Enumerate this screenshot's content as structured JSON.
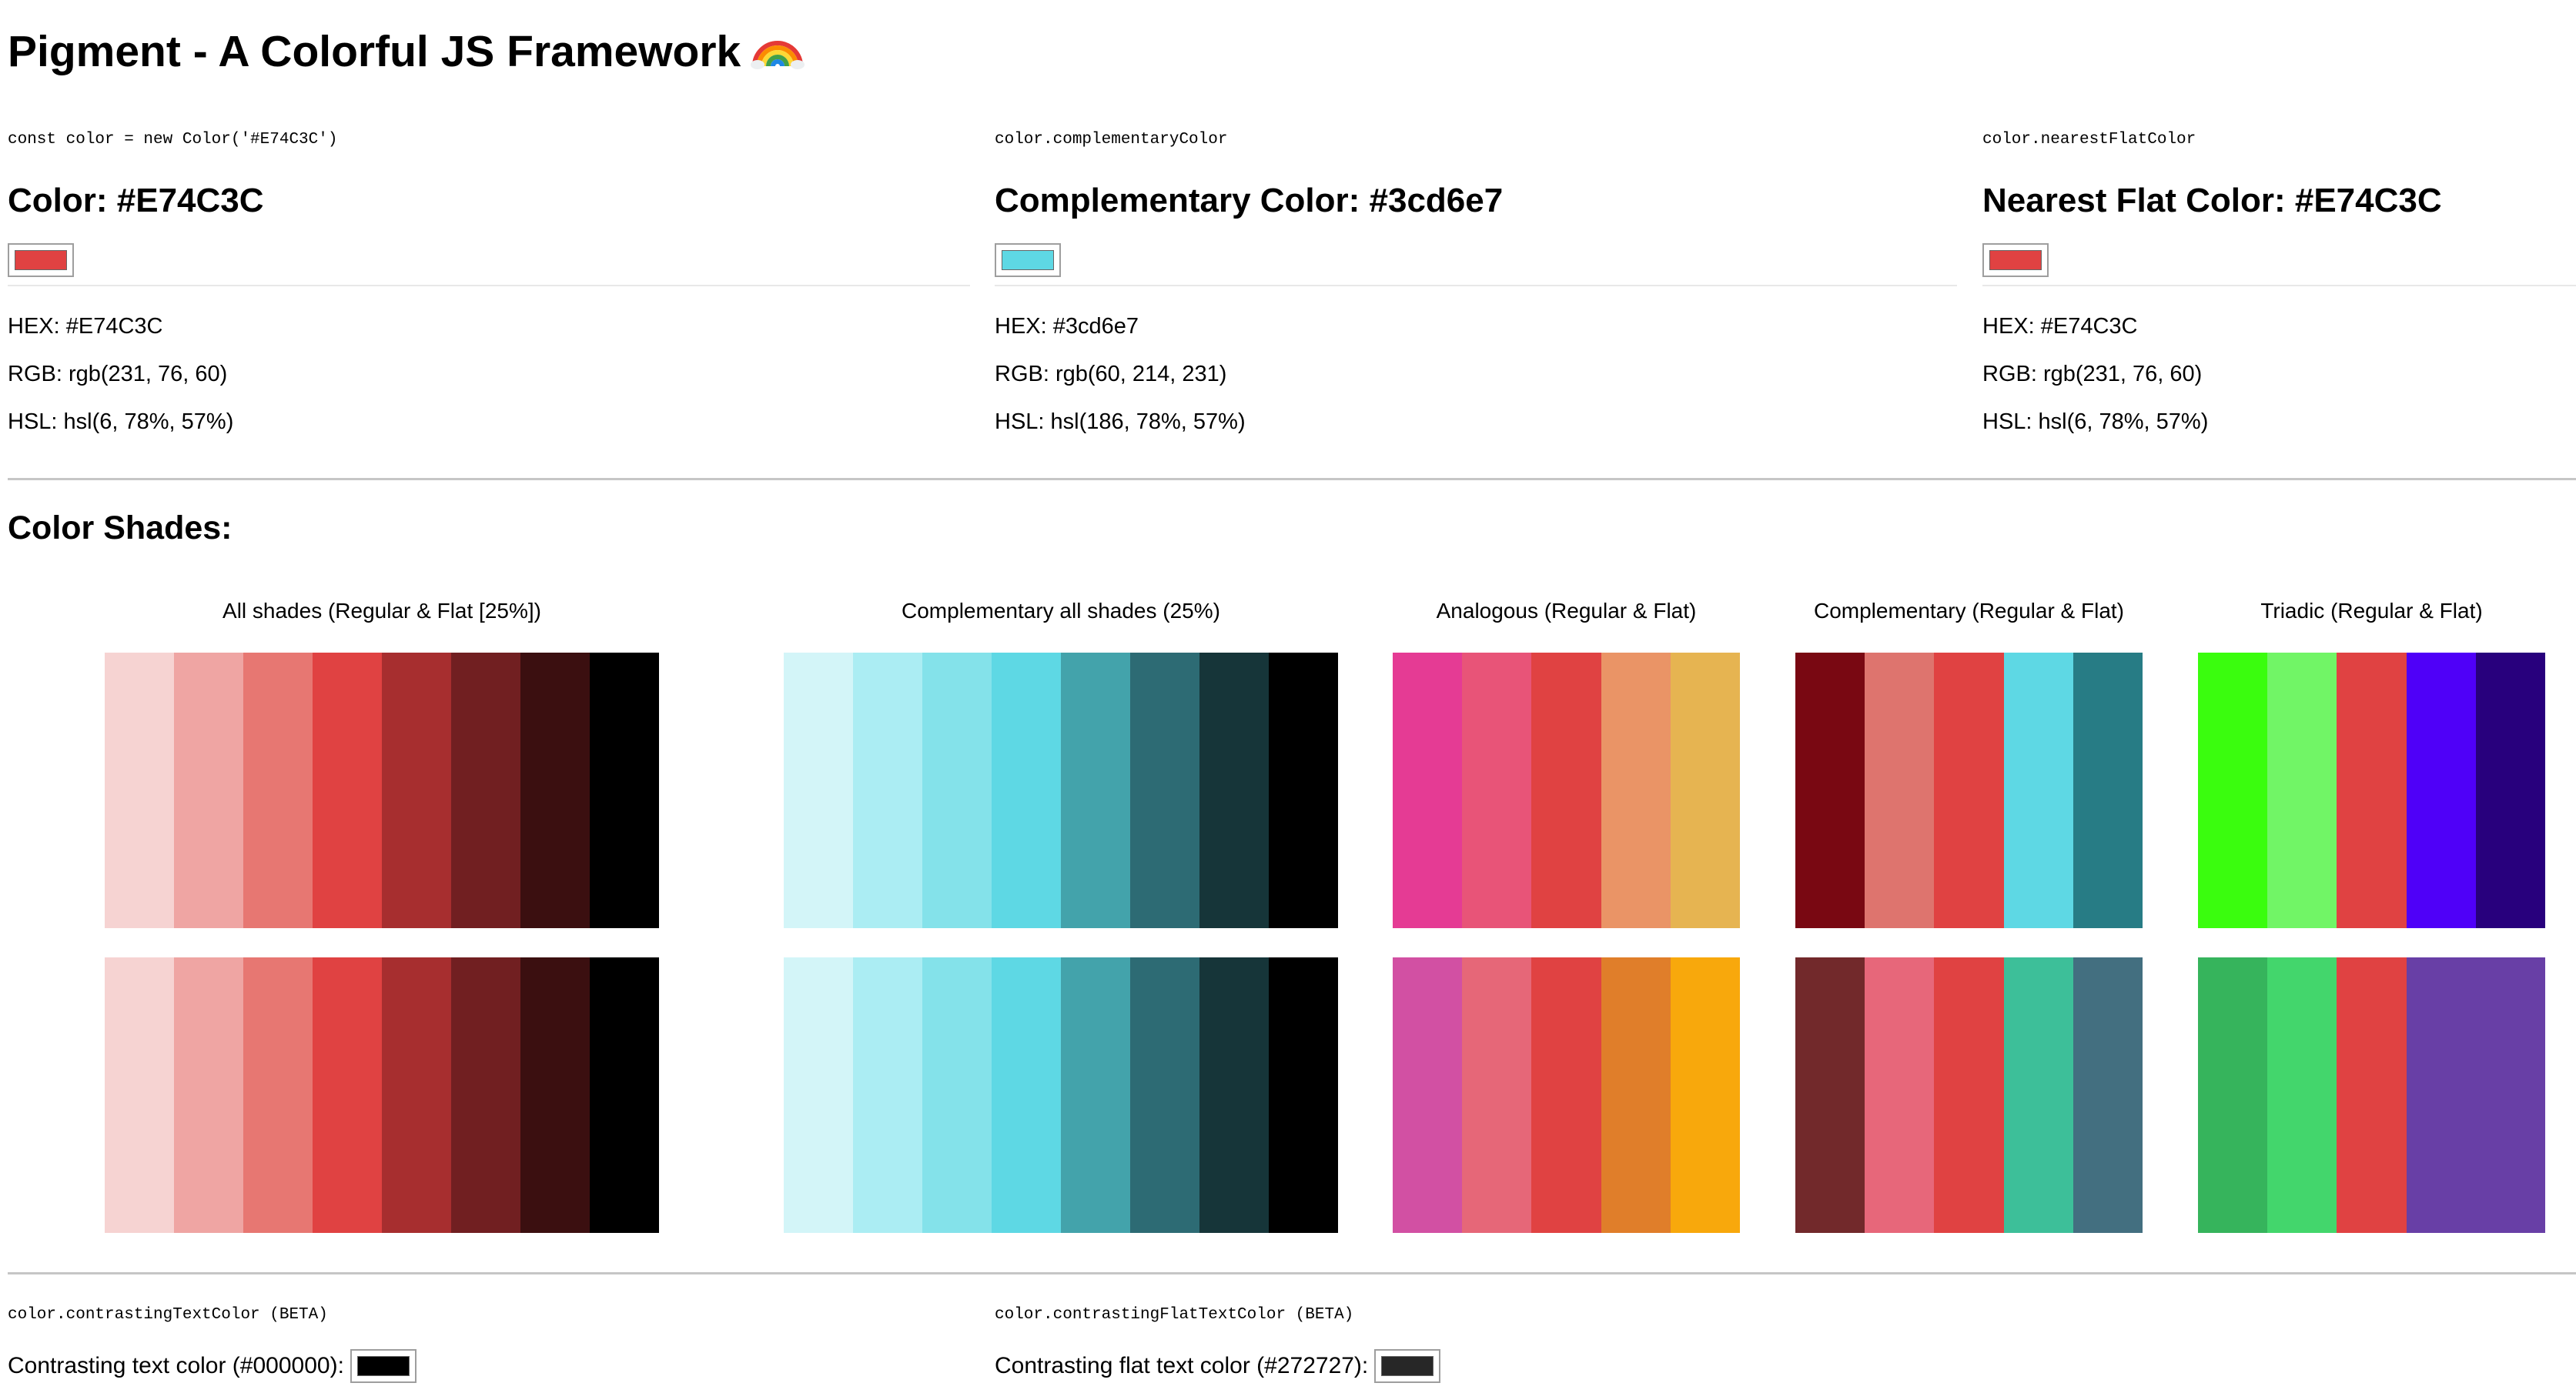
{
  "title": "Pigment - A Colorful JS Framework",
  "columns": [
    {
      "code": "const color = new Color('#E74C3C')",
      "heading": "Color: #E74C3C",
      "swatch": "#E04242",
      "hex": "HEX: #E74C3C",
      "rgb": "RGB: rgb(231, 76, 60)",
      "hsl": "HSL: hsl(6, 78%, 57%)"
    },
    {
      "code": "color.complementaryColor",
      "heading": "Complementary Color: #3cd6e7",
      "swatch": "#5ED8E4",
      "hex": "HEX: #3cd6e7",
      "rgb": "RGB: rgb(60, 214, 231)",
      "hsl": "HSL: hsl(186, 78%, 57%)"
    },
    {
      "code": "color.nearestFlatColor",
      "heading": "Nearest Flat Color: #E74C3C",
      "swatch": "#E04242",
      "hex": "HEX: #E74C3C",
      "rgb": "RGB: rgb(231, 76, 60)",
      "hsl": "HSL: hsl(6, 78%, 57%)"
    }
  ],
  "shades": {
    "title": "Color Shades:",
    "groups": [
      {
        "label": "All shades (Regular & Flat [25%])",
        "regular": [
          "#F6D3D2",
          "#EFA5A3",
          "#E77772",
          "#E04242",
          "#A72E2F",
          "#711F21",
          "#3B0F10",
          "#000000"
        ],
        "flat": [
          "#F6D3D2",
          "#EFA5A3",
          "#E77772",
          "#E04242",
          "#A72E2F",
          "#711F21",
          "#3B0F10",
          "#000000"
        ]
      },
      {
        "label": "Complementary all shades (25%)",
        "regular": [
          "#D3F5F8",
          "#ABEDF3",
          "#84E2EA",
          "#5ED8E4",
          "#43A3AB",
          "#2D6B74",
          "#163539",
          "#000000"
        ],
        "flat": [
          "#D3F5F8",
          "#ABEDF3",
          "#84E2EA",
          "#5ED8E4",
          "#43A3AB",
          "#2D6B74",
          "#163539",
          "#000000"
        ]
      },
      {
        "label": "Analogous (Regular & Flat)",
        "regular": [
          "#E53B94",
          "#E85478",
          "#E04242",
          "#EA9466",
          "#E6B451"
        ],
        "flat": [
          "#D250A3",
          "#E66778",
          "#E04242",
          "#E07E2A",
          "#F8A80C"
        ]
      },
      {
        "label": "Complementary (Regular & Flat)",
        "regular": [
          "#790812",
          "#DE746E",
          "#E04242",
          "#5ED8E4",
          "#277C85"
        ],
        "flat": [
          "#72292B",
          "#E7677A",
          "#E04242",
          "#3DBF99",
          "#436F80"
        ]
      },
      {
        "label": "Triadic (Regular & Flat)",
        "regular": [
          "#3AFD0E",
          "#71F566",
          "#E04242",
          "#4F00F8",
          "#28007D"
        ],
        "flat": [
          "#36B45C",
          "#43D66C",
          "#E04242",
          "#683FA6",
          "#683FA6"
        ]
      }
    ]
  },
  "contrast": [
    {
      "code": "color.contrastingTextColor (BETA)",
      "text": "Contrasting text color (#000000):",
      "swatch": "#000000"
    },
    {
      "code": "color.contrastingFlatTextColor (BETA)",
      "text": "Contrasting flat text color (#272727):",
      "swatch": "#272727"
    }
  ]
}
